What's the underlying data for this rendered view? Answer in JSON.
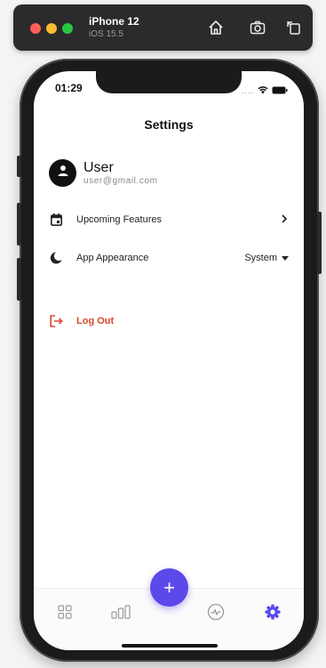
{
  "simulator": {
    "device_name": "iPhone 12",
    "os_version": "iOS 15.5",
    "controls": [
      "home-icon",
      "screenshot-icon",
      "rotate-icon"
    ]
  },
  "status_bar": {
    "time": "01:29",
    "dots": "....",
    "icons": [
      "wifi-icon",
      "battery-icon"
    ]
  },
  "page": {
    "title": "Settings"
  },
  "user": {
    "name": "User",
    "email": "user@gmail.com",
    "icon": "person-icon"
  },
  "settings": {
    "upcoming": {
      "label": "Upcoming Features",
      "icon": "calendar-icon",
      "trailing_icon": "chevron-right-icon"
    },
    "appearance": {
      "label": "App Appearance",
      "icon": "moon-icon",
      "value": "System",
      "trailing_icon": "dropdown-arrow-icon"
    },
    "logout": {
      "label": "Log Out",
      "icon": "logout-icon"
    }
  },
  "bottom_nav": {
    "items": [
      {
        "id": "dashboard",
        "icon": "grid-icon",
        "active": false
      },
      {
        "id": "stats",
        "icon": "bar-chart-icon",
        "active": false
      },
      {
        "id": "activity",
        "icon": "activity-icon",
        "active": false
      },
      {
        "id": "settings",
        "icon": "gear-icon",
        "active": true
      }
    ],
    "fab": {
      "label": "+",
      "icon": "plus-icon"
    }
  },
  "colors": {
    "accent": "#5b49e9",
    "danger": "#d9472b",
    "inactive": "#9a9a9a"
  }
}
